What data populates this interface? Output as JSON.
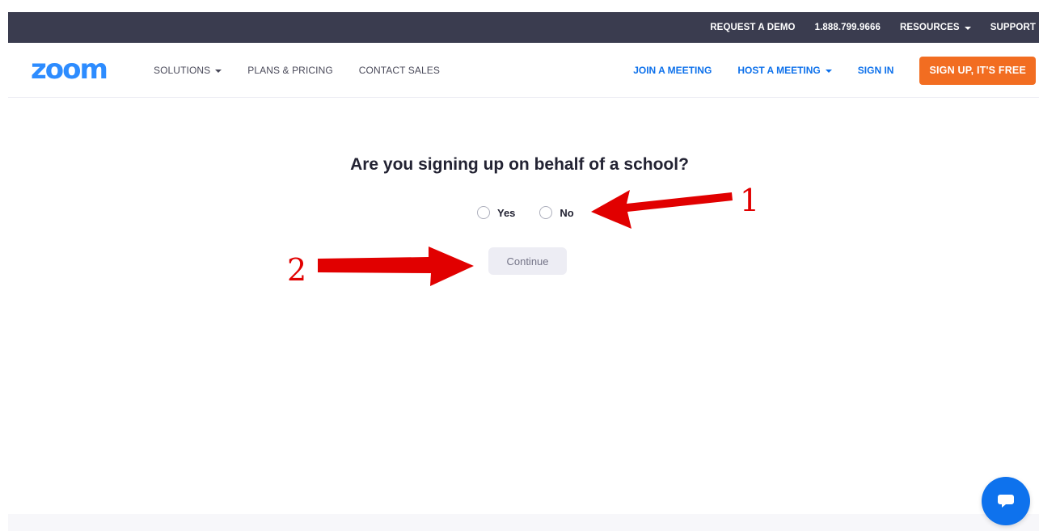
{
  "topbar": {
    "request_demo": "REQUEST A DEMO",
    "phone": "1.888.799.9666",
    "resources": "RESOURCES",
    "support": "SUPPORT"
  },
  "nav": {
    "logo": "zoom",
    "solutions": "SOLUTIONS",
    "plans_pricing": "PLANS & PRICING",
    "contact_sales": "CONTACT SALES",
    "join_meeting": "JOIN A MEETING",
    "host_meeting": "HOST A MEETING",
    "sign_in": "SIGN IN",
    "signup": "SIGN UP, IT'S FREE"
  },
  "main": {
    "question": "Are you signing up on behalf of a school?",
    "options": [
      "Yes",
      "No"
    ],
    "continue_label": "Continue"
  },
  "annotations": {
    "label_1": "1",
    "label_2": "2",
    "arrow_color": "#e10000"
  },
  "chat": {
    "icon": "chat-bubble-icon"
  },
  "colors": {
    "accent_blue": "#0e71eb",
    "brand_blue": "#2d8cff",
    "signup_orange": "#f26d21",
    "topbar_bg": "#3a3c4f"
  }
}
